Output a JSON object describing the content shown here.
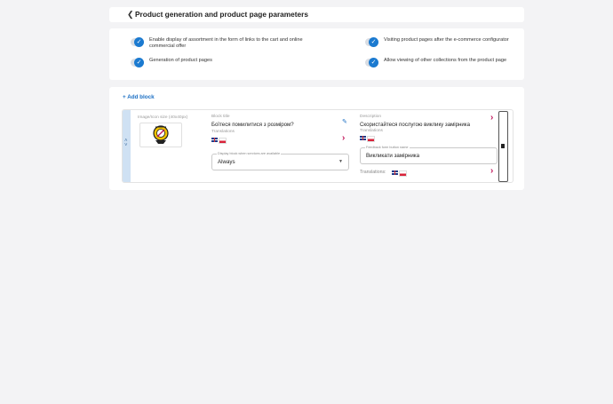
{
  "header": {
    "back_icon": "chevron-left-icon",
    "title": "Product generation and product page parameters"
  },
  "options": [
    {
      "label": "Enable display of assortment in the form of links to the cart and online commercial offer",
      "checked": true
    },
    {
      "label": "Visiting product pages after the e-commerce configurator",
      "checked": true
    },
    {
      "label": "Generation of product pages",
      "checked": true
    },
    {
      "label": "Allow viewing of other collections from the product page",
      "checked": true
    }
  ],
  "blocks_section": {
    "add_block_label": "+ Add block",
    "block": {
      "image_label": "Image/Icon size (40x40px)",
      "block_title_label": "Block title",
      "block_title_value": "Боїтеся помилитися з розміром?",
      "translations_label": "Translations",
      "display_field_legend": "Display block when services are available",
      "display_field_value": "Always",
      "description_label": "Description",
      "description_value": "Скористайтеся послугою виклику замірника",
      "feedback_legend": "Feedback form button name",
      "feedback_value": "Викликати замірника",
      "translations_inline_label": "Translations:"
    }
  },
  "colors": {
    "accent_blue": "#1b7ad0",
    "chevron_pink": "#c2185b",
    "drag_bar": "#cfe1f3"
  }
}
